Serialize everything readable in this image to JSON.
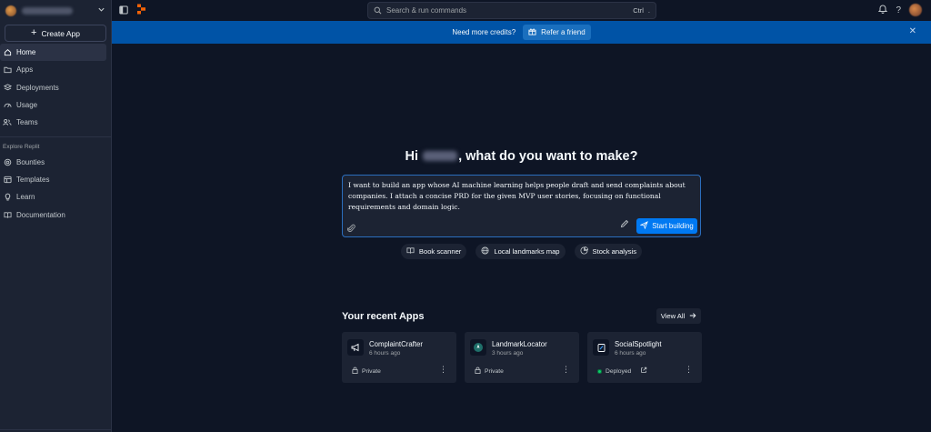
{
  "sidebar": {
    "create_label": "Create App",
    "items": [
      {
        "label": "Home",
        "icon": "home-icon",
        "active": true
      },
      {
        "label": "Apps",
        "icon": "folder-icon"
      },
      {
        "label": "Deployments",
        "icon": "deployments-icon"
      },
      {
        "label": "Usage",
        "icon": "usage-icon"
      },
      {
        "label": "Teams",
        "icon": "teams-icon"
      }
    ],
    "section_label": "Explore Replit",
    "explore_items": [
      {
        "label": "Bounties",
        "icon": "bounties-icon"
      },
      {
        "label": "Templates",
        "icon": "templates-icon"
      },
      {
        "label": "Learn",
        "icon": "learn-icon"
      },
      {
        "label": "Documentation",
        "icon": "documentation-icon"
      }
    ]
  },
  "topbar": {
    "search_placeholder": "Search & run commands",
    "shortcut_key": "Ctrl",
    "shortcut_dot": "."
  },
  "banner": {
    "message": "Need more credits?",
    "refer_label": "Refer a friend"
  },
  "main": {
    "greeting_prefix": "Hi",
    "greeting_suffix": ", what do you want to make?",
    "prompt_text": "I want to build an app whose AI machine learning helps people draft and send complaints about companies. I attach a concise PRD for the given MVP user stories, focusing on functional requirements and domain logic.",
    "start_label": "Start building",
    "chips": [
      {
        "label": "Book scanner",
        "icon": "book-icon"
      },
      {
        "label": "Local landmarks map",
        "icon": "globe-icon"
      },
      {
        "label": "Stock analysis",
        "icon": "chart-icon"
      }
    ],
    "recent_title": "Your recent Apps",
    "view_all_label": "View All",
    "apps": [
      {
        "name": "ComplaintCrafter",
        "time": "6 hours ago",
        "status": "Private"
      },
      {
        "name": "LandmarkLocator",
        "time": "3 hours ago",
        "status": "Private"
      },
      {
        "name": "SocialSpotlight",
        "time": "6 hours ago",
        "status": "Deployed"
      }
    ]
  },
  "colors": {
    "background": "#0e1525",
    "surface": "#1c2333",
    "banner": "#0053a6",
    "accent": "#0079f2",
    "deployed": "#0cce6b"
  }
}
